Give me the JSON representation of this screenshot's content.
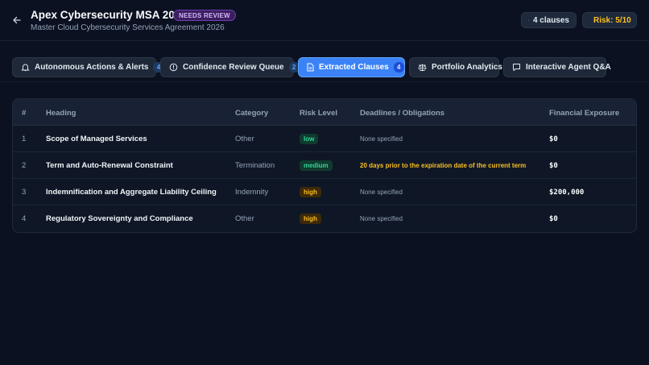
{
  "header": {
    "title": "Apex Cybersecurity MSA 2026",
    "status_badge": "NEEDS REVIEW",
    "subtitle": "Master Cloud Cybersecurity Services Agreement 2026",
    "clauses_pill": "4 clauses",
    "risk_pill": "Risk: 5/10"
  },
  "tabs": [
    {
      "label": "Autonomous Actions & Alerts",
      "count": "4",
      "icon": "bell-icon"
    },
    {
      "label": "Confidence Review Queue",
      "count": "2",
      "icon": "alert-circle-icon"
    },
    {
      "label": "Extracted Clauses",
      "count": "4",
      "icon": "document-icon",
      "active": true
    },
    {
      "label": "Portfolio Analytics",
      "icon": "scale-icon"
    },
    {
      "label": "Interactive Agent Q&A",
      "icon": "chat-icon"
    }
  ],
  "table": {
    "columns": [
      "#",
      "Heading",
      "Category",
      "Risk Level",
      "Deadlines / Obligations",
      "Financial Exposure"
    ],
    "rows": [
      {
        "num": "1",
        "heading": "Scope of Managed Services",
        "category": "Other",
        "risk": "low",
        "deadline": "None specified",
        "exposure": "$0"
      },
      {
        "num": "2",
        "heading": "Term and Auto-Renewal Constraint",
        "category": "Termination",
        "risk": "medium",
        "deadline": "20 days prior to the expiration date of the current term",
        "exposure": "$0"
      },
      {
        "num": "3",
        "heading": "Indemnification and Aggregate Liability Ceiling",
        "category": "Indemnity",
        "risk": "high",
        "deadline": "None specified",
        "exposure": "$200,000"
      },
      {
        "num": "4",
        "heading": "Regulatory Sovereignty and Compliance",
        "category": "Other",
        "risk": "high",
        "deadline": "None specified",
        "exposure": "$0"
      }
    ]
  },
  "colors": {
    "background": "#0b1120",
    "accent": "#3b82f6",
    "badge_purple": "#d8b4fe",
    "warning": "#fbbf24",
    "success": "#34d399"
  }
}
